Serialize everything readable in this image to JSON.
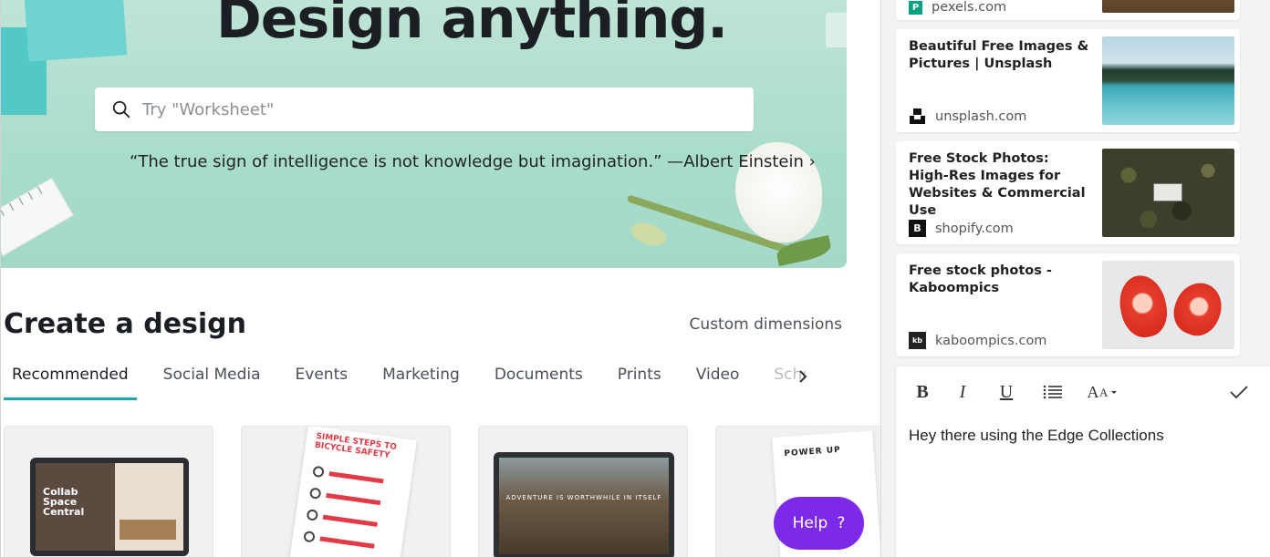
{
  "canva": {
    "hero": {
      "title": "Design anything.",
      "search_placeholder": "Try \"Worksheet\"",
      "quote": "“The true sign of intelligence is not knowledge but imagination.” —Albert Einstein ›"
    },
    "create": {
      "title": "Create a design",
      "custom_dimensions": "Custom dimensions"
    },
    "tabs": [
      {
        "label": "Recommended",
        "active": true
      },
      {
        "label": "Social Media"
      },
      {
        "label": "Events"
      },
      {
        "label": "Marketing"
      },
      {
        "label": "Documents"
      },
      {
        "label": "Prints"
      },
      {
        "label": "Video"
      },
      {
        "label": "Scho"
      }
    ],
    "cards": [
      {
        "text": "Collab Space Central"
      },
      {
        "text": "SIMPLE STEPS TO BICYCLE SAFETY"
      },
      {
        "text": "ADVENTURE IS WORTHWHILE IN ITSELF"
      },
      {
        "text": "POWER UP"
      }
    ],
    "help": {
      "label": "Help",
      "icon": "?"
    },
    "colors": {
      "accent": "#1ea7b0",
      "help": "#7d2ae8"
    }
  },
  "collections": {
    "items": [
      {
        "title": "",
        "source": "pexels.com",
        "favicon": "pexels-icon"
      },
      {
        "title": "Beautiful Free Images & Pictures | Unsplash",
        "source": "unsplash.com",
        "favicon": "unsplash-icon"
      },
      {
        "title": "Free Stock Photos: High-Res Images for Websites & Commercial Use",
        "source": "shopify.com",
        "favicon": "shopify-icon"
      },
      {
        "title": "Free stock photos - Kaboompics",
        "source": "kaboompics.com",
        "favicon": "kaboompics-icon"
      }
    ],
    "editor": {
      "bold": "B",
      "italic": "I",
      "underline": "U",
      "fontsize": "A",
      "note": "Hey there using the Edge Collections"
    }
  }
}
